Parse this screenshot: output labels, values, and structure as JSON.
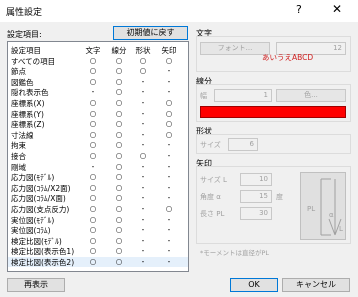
{
  "window": {
    "title": "属性設定",
    "help_glyph": "?",
    "close_glyph": "✕"
  },
  "items_label": "設定項目:",
  "reset_button": "初期値に戻す",
  "list": {
    "headers": [
      "設定項目",
      "文字",
      "線分",
      "形状",
      "矢印"
    ],
    "rows": [
      [
        "すべての項目",
        "○",
        "○",
        "○",
        "○"
      ],
      [
        "節点",
        "○",
        "○",
        "○",
        "-"
      ],
      [
        "図鑑色",
        "○",
        "○",
        "-",
        "-"
      ],
      [
        "隠れ表示色",
        "-",
        "○",
        "-",
        "-"
      ],
      [
        "座標系(X)",
        "○",
        "○",
        "-",
        "○"
      ],
      [
        "座標系(Y)",
        "○",
        "○",
        "-",
        "○"
      ],
      [
        "座標系(Z)",
        "○",
        "○",
        "-",
        "○"
      ],
      [
        "寸法線",
        "○",
        "○",
        "-",
        "○"
      ],
      [
        "拘束",
        "○",
        "○",
        "-",
        "-"
      ],
      [
        "接合",
        "○",
        "○",
        "○",
        "-"
      ],
      [
        "剛域",
        "-",
        "○",
        "-",
        "-"
      ],
      [
        "応力図(ﾓﾃﾞﾙ)",
        "○",
        "○",
        "-",
        "-"
      ],
      [
        "応力図(ｺﾗﾑ/X2面)",
        "○",
        "○",
        "-",
        "-"
      ],
      [
        "応力図(ｺﾗﾑ/X面)",
        "○",
        "○",
        "-",
        "-"
      ],
      [
        "応力図(支点反力)",
        "○",
        "○",
        "-",
        "○"
      ],
      [
        "実位図(ﾓﾃﾞﾙ)",
        "○",
        "○",
        "-",
        "-"
      ],
      [
        "実位図(ｺﾗﾑ)",
        "○",
        "○",
        "-",
        "-"
      ],
      [
        "検定比図(ﾓﾃﾞﾙ)",
        "○",
        "○",
        "-",
        "-"
      ],
      [
        "検定比図(表示色1)",
        "○",
        "○",
        "-",
        "-"
      ],
      [
        "検定比図(表示色2)",
        "○",
        "○",
        "-",
        "-"
      ]
    ]
  },
  "redraw_button": "再表示",
  "ok_button": "OK",
  "cancel_button": "キャンセル",
  "text_section": {
    "title": "文字",
    "font_button": "フォント...",
    "size_value": "12",
    "sample": "あいうえABCD",
    "sample_color": "#d02020"
  },
  "line_section": {
    "title": "線分",
    "width_label": "幅",
    "width_value": "1",
    "color_button": "色...",
    "color": "#ff0000"
  },
  "shape_section": {
    "title": "形状",
    "size_label": "サイズ",
    "size_value": "6"
  },
  "arrow_section": {
    "title": "矢印",
    "size_label": "サイズ L",
    "size_value": "10",
    "angle_label": "角度 α",
    "angle_value": "15",
    "angle_unit": "度",
    "length_label": "長さ PL",
    "length_value": "30",
    "note": "*モーメントは直径がPL",
    "preview_labels": {
      "pl": "PL",
      "alpha": "α",
      "l": "L"
    }
  }
}
